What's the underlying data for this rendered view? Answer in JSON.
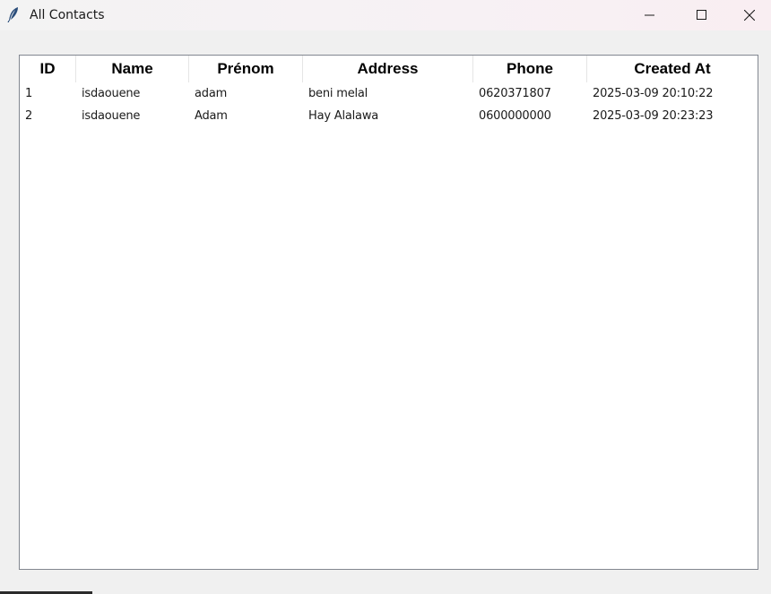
{
  "window": {
    "title": "All Contacts",
    "icon": "feather-icon",
    "controls": [
      "minimize-icon",
      "maximize-icon",
      "close-icon"
    ]
  },
  "table": {
    "columns": [
      "ID",
      "Name",
      "Prénom",
      "Address",
      "Phone",
      "Created At"
    ],
    "rows": [
      [
        "1",
        "isdaouene",
        "adam",
        "beni melal",
        "0620371807",
        "2025-03-09 20:10:22"
      ],
      [
        "2",
        "isdaouene",
        "Adam",
        "Hay Alalawa",
        "0600000000",
        "2025-03-09 20:23:23"
      ]
    ]
  }
}
